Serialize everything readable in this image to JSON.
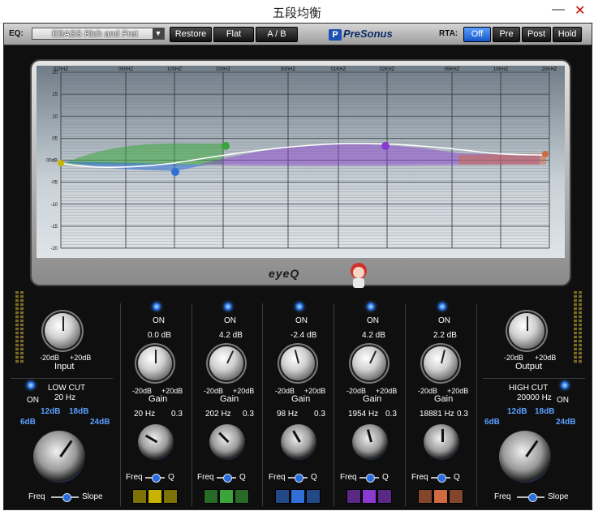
{
  "window": {
    "title": "五段均衡",
    "minimize": "—",
    "close": "✕"
  },
  "toolbar": {
    "eq_label": "EQ:",
    "preset": "EBASS Rich and Fret",
    "restore": "Restore",
    "flat": "Flat",
    "ab": "A / B",
    "brand": "PreSonus",
    "rta_label": "RTA:",
    "rta_off": "Off",
    "rta_pre": "Pre",
    "rta_post": "Post",
    "rta_hold": "Hold"
  },
  "graph": {
    "freq_labels": [
      "020HZ",
      "050HZ",
      "100HZ",
      "200HZ",
      "500HZ",
      "01KHZ",
      "02KHZ",
      "05KHZ",
      "10KHZ",
      "20KHZ"
    ],
    "db_labels": [
      "20",
      "15",
      "10",
      "05",
      "00dB",
      "-05",
      "-10",
      "-15",
      "-20"
    ],
    "brand": "eyeQ"
  },
  "input": {
    "scale_min": "-20dB",
    "scale_max": "+20dB",
    "label": "Input"
  },
  "output": {
    "scale_min": "-20dB",
    "scale_max": "+20dB",
    "label": "Output"
  },
  "low_cut": {
    "title": "LOW CUT",
    "value": "20 Hz",
    "on": "ON",
    "slopes": [
      "6dB",
      "12dB",
      "18dB",
      "24dB"
    ],
    "freq": "Freq",
    "slope": "Slope"
  },
  "high_cut": {
    "title": "HIGH CUT",
    "value": "20000 Hz",
    "on": "ON",
    "slopes": [
      "6dB",
      "12dB",
      "18dB",
      "24dB"
    ],
    "freq": "Freq",
    "slope": "Slope"
  },
  "bands": [
    {
      "on": "ON",
      "gain": "0.0 dB",
      "freq": "20 Hz",
      "q": "0.3",
      "color": "#c8b400",
      "gmin": "-20dB",
      "gmax": "+20dB",
      "gain_label": "Gain",
      "freq_label": "Freq",
      "q_label": "Q"
    },
    {
      "on": "ON",
      "gain": "4.2 dB",
      "freq": "202 Hz",
      "q": "0.3",
      "color": "#3aa63a",
      "gmin": "-20dB",
      "gmax": "+20dB",
      "gain_label": "Gain",
      "freq_label": "Freq",
      "q_label": "Q"
    },
    {
      "on": "ON",
      "gain": "-2.4 dB",
      "freq": "98 Hz",
      "q": "0.3",
      "color": "#2f6fd6",
      "gmin": "-20dB",
      "gmax": "+20dB",
      "gain_label": "Gain",
      "freq_label": "Freq",
      "q_label": "Q"
    },
    {
      "on": "ON",
      "gain": "4.2 dB",
      "freq": "1954 Hz",
      "q": "0.3",
      "color": "#8a3ad0",
      "gmin": "-20dB",
      "gmax": "+20dB",
      "gain_label": "Gain",
      "freq_label": "Freq",
      "q_label": "Q"
    },
    {
      "on": "ON",
      "gain": "2.2 dB",
      "freq": "18881 Hz",
      "q": "0.3",
      "color": "#d06a40",
      "gmin": "-20dB",
      "gmax": "+20dB",
      "gain_label": "Gain",
      "freq_label": "Freq",
      "q_label": "Q"
    }
  ]
}
